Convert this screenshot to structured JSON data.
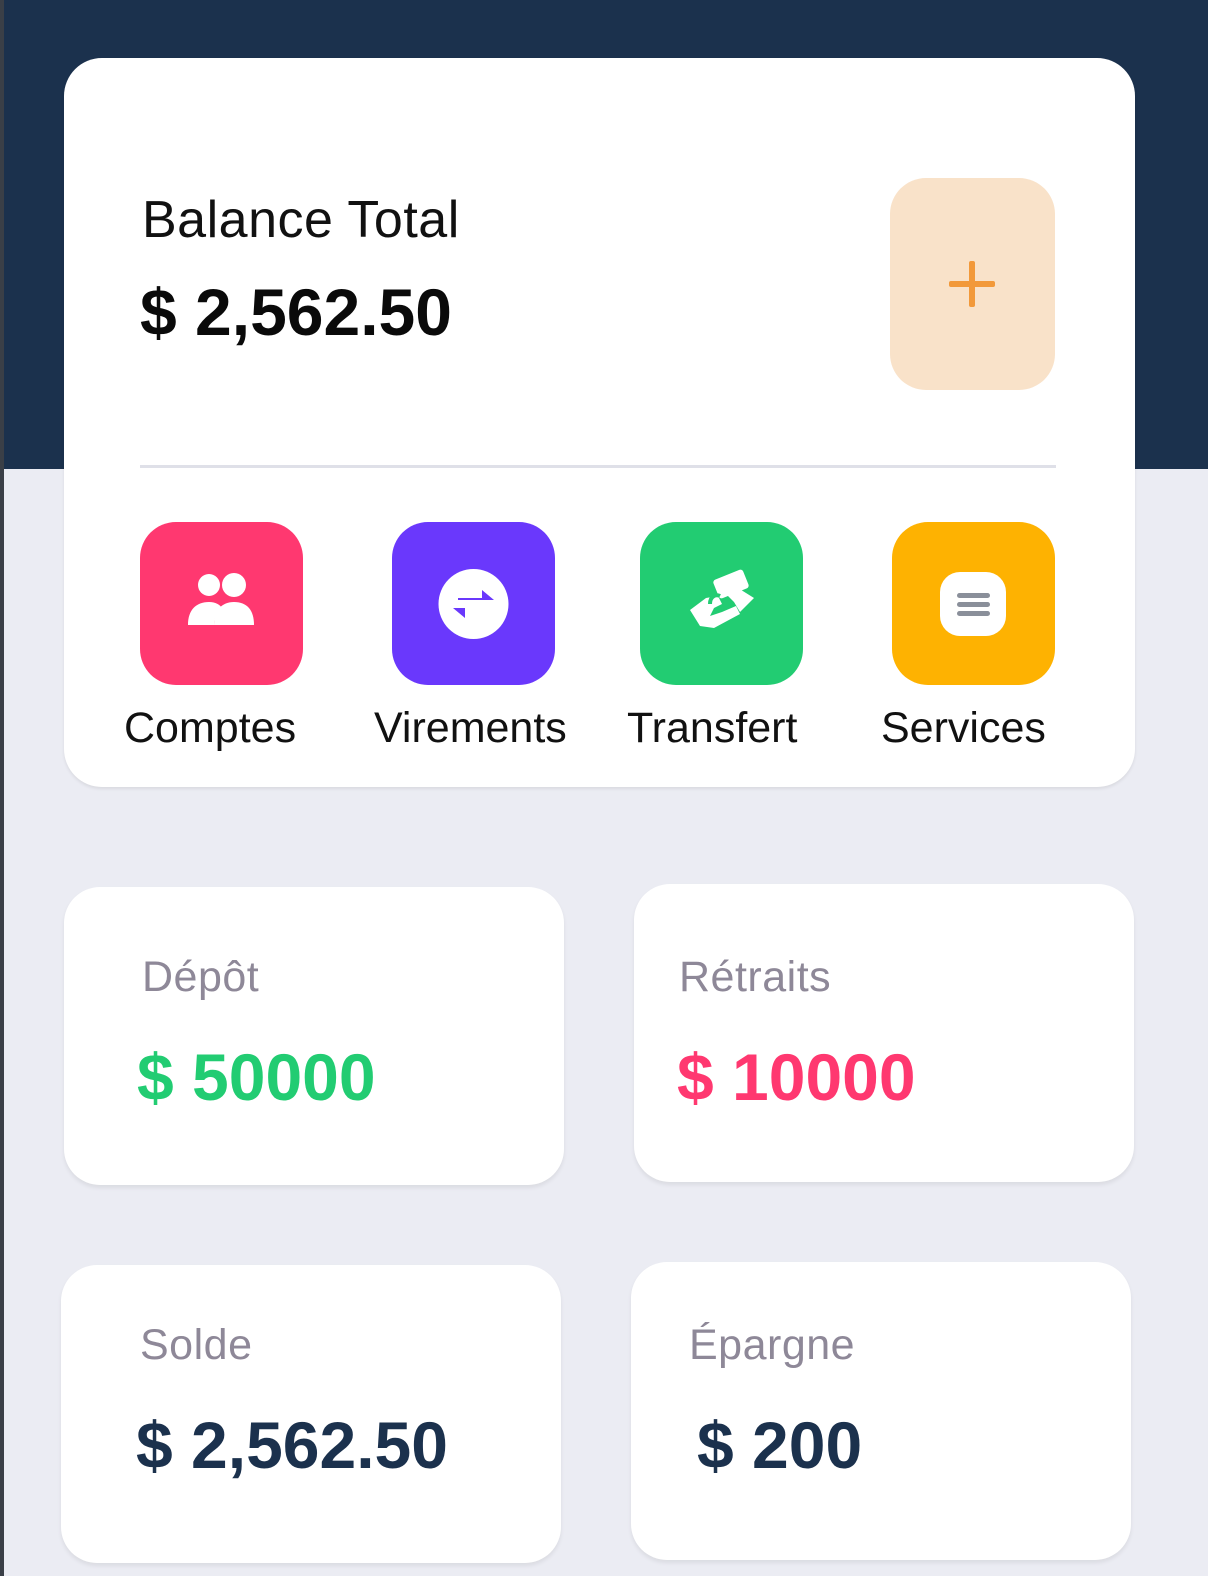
{
  "balance": {
    "label": "Balance Total",
    "amount": "$ 2,562.50",
    "add_icon": "plus-icon"
  },
  "actions": [
    {
      "label": "Comptes",
      "icon": "users-icon",
      "color": "#ff3870"
    },
    {
      "label": "Virements",
      "icon": "transfer-arrows-icon",
      "color": "#6a38fc"
    },
    {
      "label": "Transfert",
      "icon": "handshake-money-icon",
      "color": "#22cc72"
    },
    {
      "label": "Services",
      "icon": "menu-list-icon",
      "color": "#feb201"
    }
  ],
  "stats": [
    {
      "label": "Dépôt",
      "value": "$ 50000",
      "color": "#22cc72"
    },
    {
      "label": "Rétraits",
      "value": "$ 10000",
      "color": "#ff3870"
    },
    {
      "label": "Solde",
      "value": "$ 2,562.50",
      "color": "#1b314d"
    },
    {
      "label": "Épargne",
      "value": "$ 200",
      "color": "#1b314d"
    }
  ],
  "colors": {
    "header": "#1b314d",
    "background": "#ebecf3",
    "add_button": "#f9e2c9",
    "add_icon": "#f2993a"
  }
}
